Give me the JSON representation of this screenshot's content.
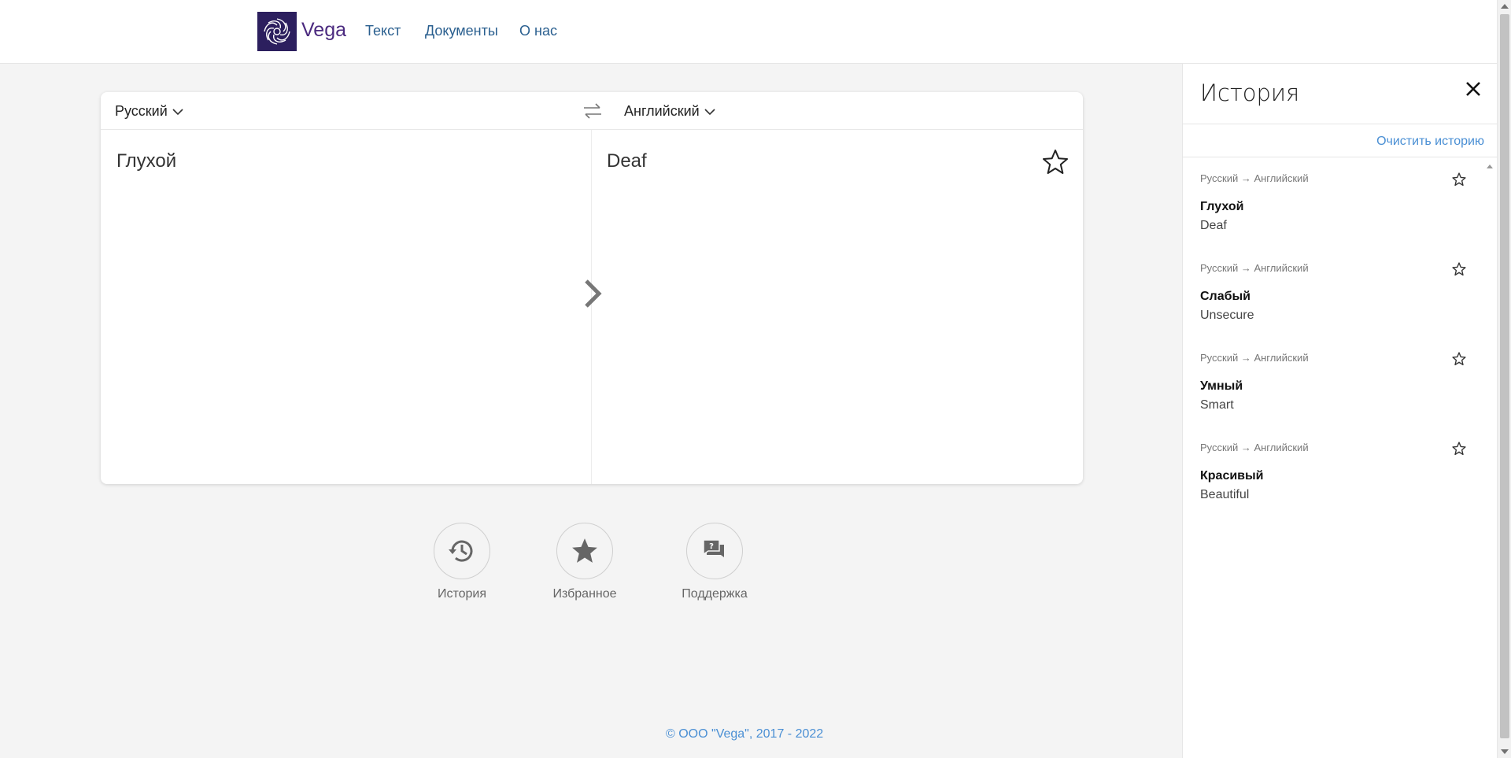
{
  "header": {
    "brand": "Vega",
    "nav": [
      {
        "label": "Текст"
      },
      {
        "label": "Документы"
      },
      {
        "label": "О нас"
      }
    ]
  },
  "translator": {
    "source_lang": "Русский",
    "target_lang": "Английский",
    "source_text": "Глухой",
    "target_text": "Deaf"
  },
  "actions": [
    {
      "label": "История",
      "icon": "history-icon"
    },
    {
      "label": "Избранное",
      "icon": "star-icon"
    },
    {
      "label": "Поддержка",
      "icon": "support-chat-icon"
    }
  ],
  "footer": {
    "copyright": "© ООО \"Vega\", 2017 - 2022"
  },
  "history": {
    "title": "История",
    "clear_label": "Очистить историю",
    "items": [
      {
        "pair": "Русский → Английский",
        "source": "Глухой",
        "target": "Deaf"
      },
      {
        "pair": "Русский → Английский",
        "source": "Слабый",
        "target": "Unsecure"
      },
      {
        "pair": "Русский → Английский",
        "source": "Умный",
        "target": "Smart"
      },
      {
        "pair": "Русский → Английский",
        "source": "Красивый",
        "target": "Beautiful"
      }
    ]
  },
  "colors": {
    "brand": "#4b2a7f",
    "logo_bg": "#2c1f5e",
    "link": "#2a5f8f",
    "accent": "#4a8fd4"
  }
}
